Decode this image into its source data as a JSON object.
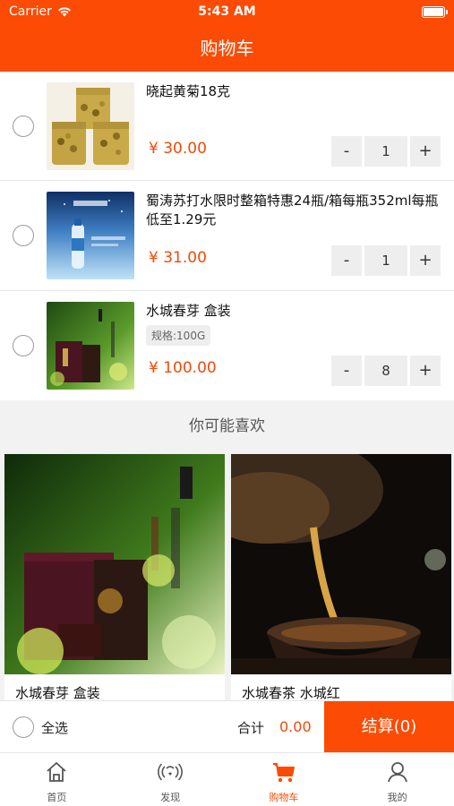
{
  "status_bar": {
    "carrier": "Carrier",
    "time": "5:43 AM"
  },
  "header": {
    "title": "购物车"
  },
  "cart_items": [
    {
      "name": "晓起黄菊18克",
      "spec": "",
      "price": "¥ 30.00",
      "quantity": "1"
    },
    {
      "name": "蜀涛苏打水限时整箱特惠24瓶/箱每瓶352ml每瓶低至1.29元",
      "spec": "",
      "price": "¥ 31.00",
      "quantity": "1"
    },
    {
      "name": "水城春芽 盒装",
      "spec": "规格:100G",
      "price": "¥ 100.00",
      "quantity": "8"
    }
  ],
  "stepper": {
    "minus": "-",
    "plus": "+"
  },
  "recommend": {
    "heading": "你可能喜欢",
    "items": [
      {
        "title": "水城春芽 盒装"
      },
      {
        "title": "水城春茶  水城红"
      }
    ]
  },
  "cart_bar": {
    "select_all": "全选",
    "total_label": "合计",
    "total_value": "0.00",
    "checkout": "结算(0)"
  },
  "tabs": [
    {
      "label": "首页",
      "icon": "home-icon"
    },
    {
      "label": "发现",
      "icon": "broadcast-icon"
    },
    {
      "label": "购物车",
      "icon": "cart-icon",
      "active": true
    },
    {
      "label": "我的",
      "icon": "user-icon"
    }
  ],
  "colors": {
    "accent": "#fc4b05",
    "price": "#f04a0a"
  }
}
